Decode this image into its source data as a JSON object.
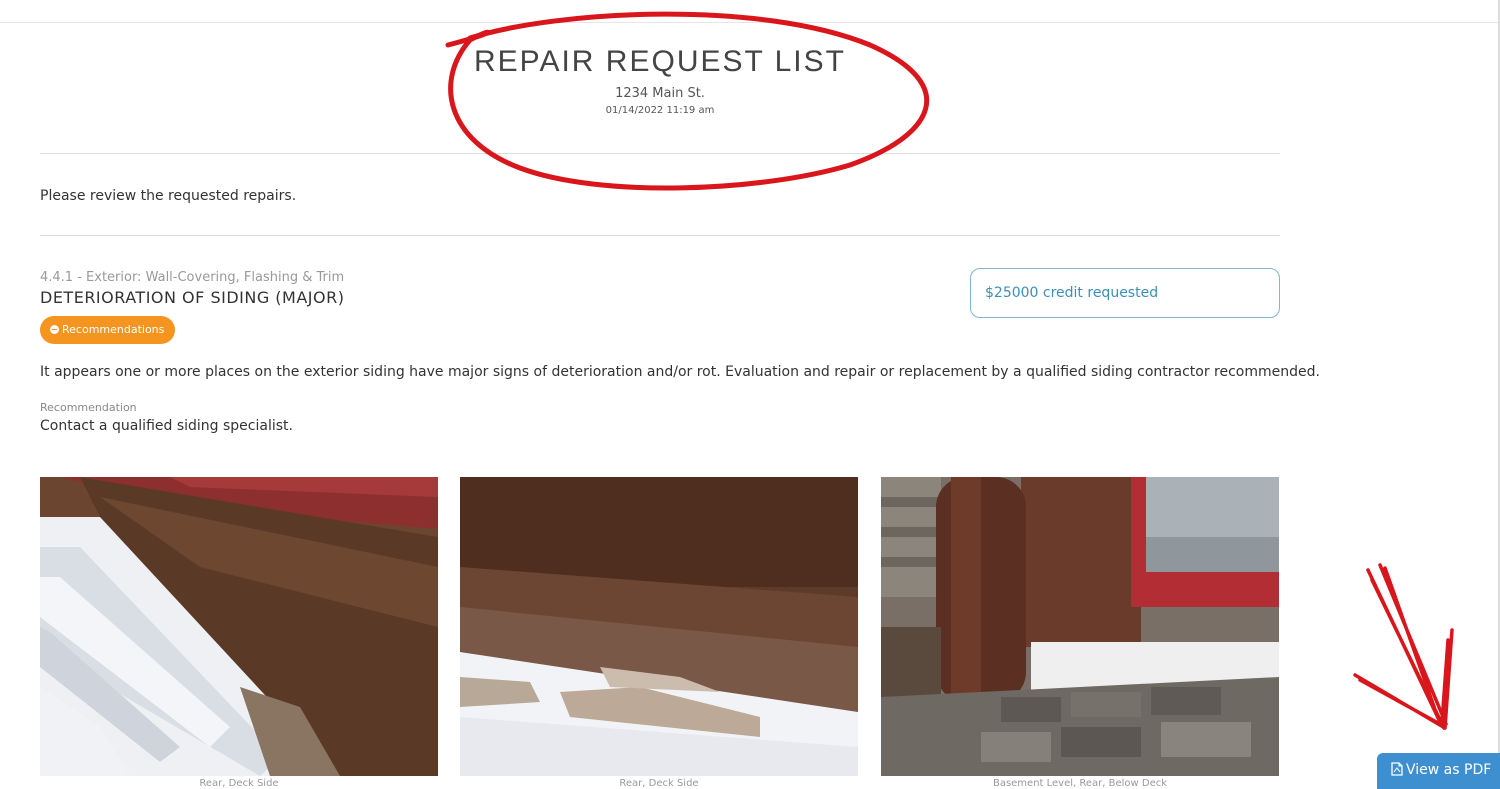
{
  "header": {
    "title": "REPAIR REQUEST LIST",
    "address": "1234 Main St.",
    "date": "01/14/2022 11:19 am"
  },
  "intro": "Please review the requested repairs.",
  "item": {
    "category": "4.4.1 - Exterior: Wall-Covering, Flashing & Trim",
    "title": "DETERIORATION OF SIDING (MAJOR)",
    "badge_label": "Recommendations",
    "credit": "$25000 credit requested",
    "description": "It appears one or more places on the exterior siding have major signs of deterioration and/or rot. Evaluation and repair or replacement by a qualified siding contractor recommended.",
    "recommendation_label": "Recommendation",
    "recommendation_text": "Contact a qualified siding specialist."
  },
  "photos": [
    {
      "caption": "Rear, Deck Side"
    },
    {
      "caption": "Rear, Deck Side"
    },
    {
      "caption": "Basement Level, Rear, Below Deck"
    }
  ],
  "pdf_button": {
    "label": "View as PDF"
  },
  "colors": {
    "badge": "#f5941e",
    "credit_border": "#7fb6cf",
    "credit_text": "#3d8eb9",
    "pdf_button": "#3e8fd0",
    "annotation": "#d8161b"
  }
}
